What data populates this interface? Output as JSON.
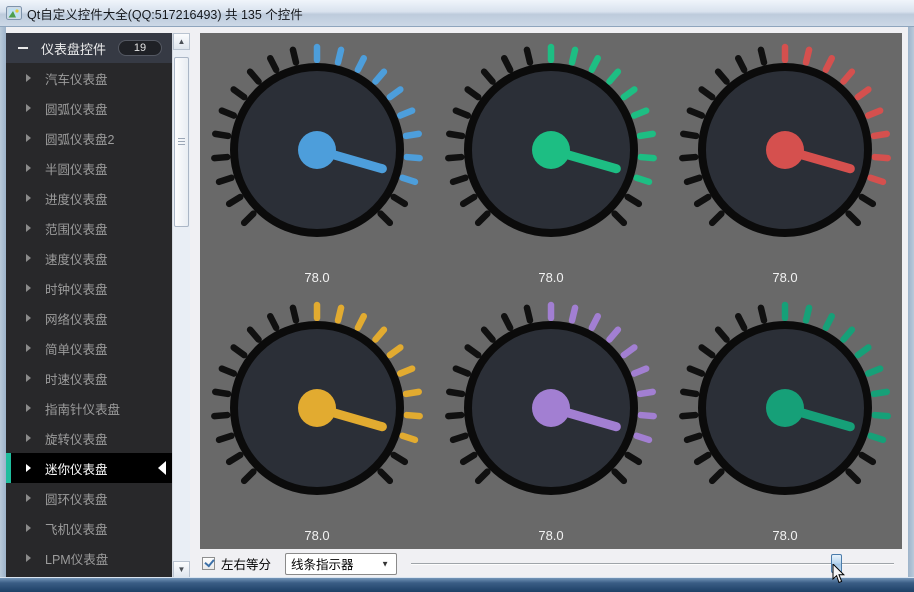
{
  "window": {
    "title": "Qt自定义控件大全(QQ:517216493) 共 135 个控件"
  },
  "sidebar": {
    "header": {
      "label": "仪表盘控件",
      "badge": "19"
    },
    "items": [
      {
        "label": "汽车仪表盘",
        "selected": false
      },
      {
        "label": "圆弧仪表盘",
        "selected": false
      },
      {
        "label": "圆弧仪表盘2",
        "selected": false
      },
      {
        "label": "半圆仪表盘",
        "selected": false
      },
      {
        "label": "进度仪表盘",
        "selected": false
      },
      {
        "label": "范围仪表盘",
        "selected": false
      },
      {
        "label": "速度仪表盘",
        "selected": false
      },
      {
        "label": "时钟仪表盘",
        "selected": false
      },
      {
        "label": "网络仪表盘",
        "selected": false
      },
      {
        "label": "简单仪表盘",
        "selected": false
      },
      {
        "label": "时速仪表盘",
        "selected": false
      },
      {
        "label": "指南针仪表盘",
        "selected": false
      },
      {
        "label": "旋转仪表盘",
        "selected": false
      },
      {
        "label": "迷你仪表盘",
        "selected": true
      },
      {
        "label": "圆环仪表盘",
        "selected": false
      },
      {
        "label": "飞机仪表盘",
        "selected": false
      },
      {
        "label": "LPM仪表盘",
        "selected": false
      }
    ],
    "scrollbar": {
      "up_icon": "▲",
      "down_icon": "▼"
    }
  },
  "gauges": {
    "config": {
      "start_angle": -135,
      "end_angle": 135,
      "tick_count": 21,
      "colored_start": -1,
      "colored_end": 109,
      "needle_angle": 106,
      "panel_color": "#696969",
      "face_color": "#2b2f37",
      "ring_color": "#0b0b0b",
      "tick_color": "#101010",
      "value_color": "#f2f2f2"
    },
    "items": [
      {
        "name": "gauge-blue",
        "color": "#4d9edb",
        "value": "78.0"
      },
      {
        "name": "gauge-green",
        "color": "#1dbe83",
        "value": "78.0"
      },
      {
        "name": "gauge-red",
        "color": "#d5504e",
        "value": "78.0"
      },
      {
        "name": "gauge-yellow",
        "color": "#e2ab30",
        "value": "78.0"
      },
      {
        "name": "gauge-purple",
        "color": "#a27fd2",
        "value": "78.0"
      },
      {
        "name": "gauge-teal",
        "color": "#16a078",
        "value": "78.0"
      }
    ]
  },
  "bottom_bar": {
    "checkbox_label": "左右等分",
    "checkbox_checked": true,
    "combo_value": "线条指示器",
    "combo_arrow": "▼",
    "slider_percent": 88
  }
}
